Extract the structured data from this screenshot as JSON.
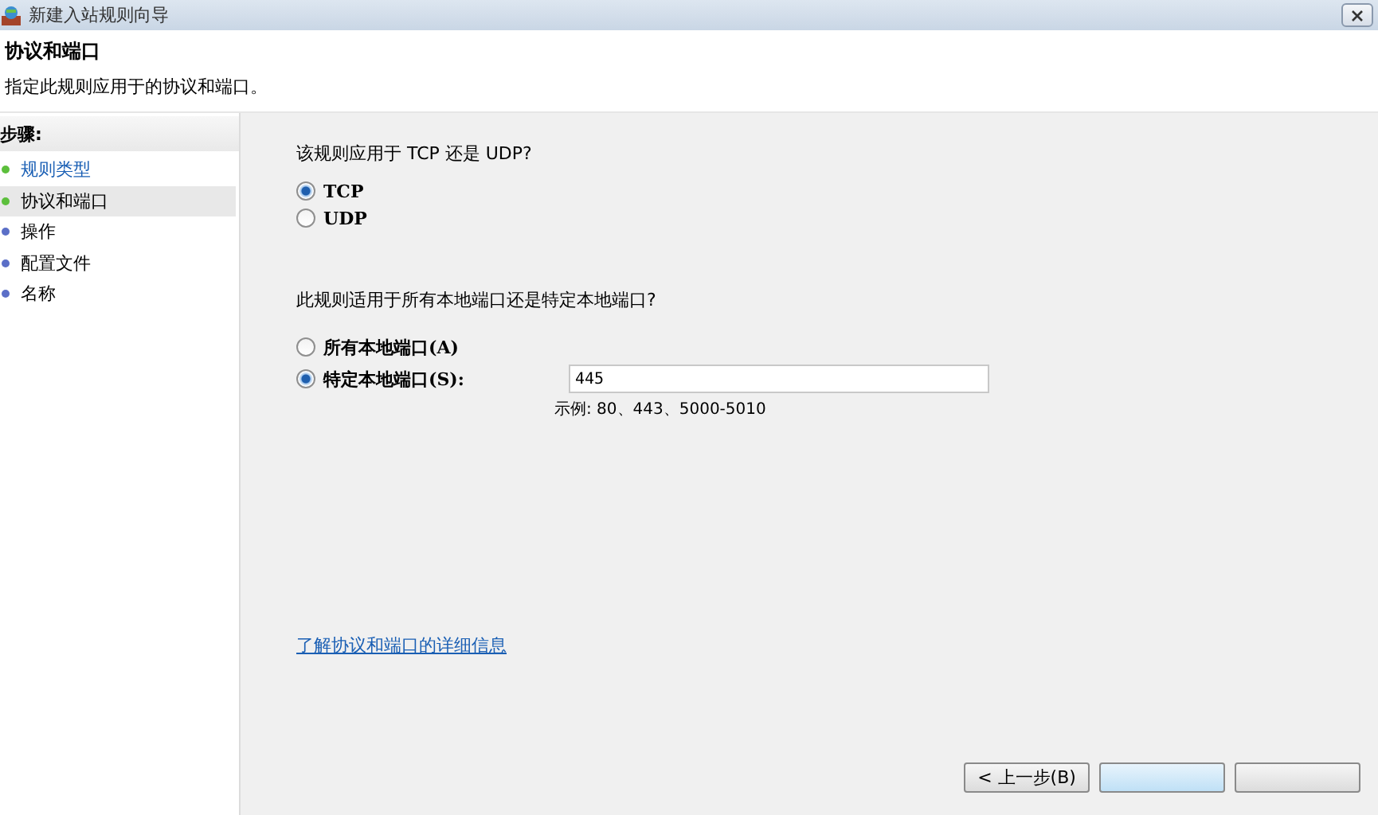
{
  "window": {
    "title": "新建入站规则向导"
  },
  "header": {
    "title": "协议和端口",
    "subtitle": "指定此规则应用于的协议和端口。"
  },
  "steps": {
    "heading": "步骤:",
    "items": [
      {
        "label": "规则类型",
        "done": true,
        "selected": false
      },
      {
        "label": "协议和端口",
        "done": true,
        "selected": true
      },
      {
        "label": "操作",
        "done": false,
        "selected": false
      },
      {
        "label": "配置文件",
        "done": false,
        "selected": false
      },
      {
        "label": "名称",
        "done": false,
        "selected": false
      }
    ]
  },
  "protocol": {
    "question": "该规则应用于 TCP 还是 UDP?",
    "options": [
      {
        "label": "TCP",
        "selected": true
      },
      {
        "label": "UDP",
        "selected": false
      }
    ]
  },
  "ports": {
    "question": "此规则适用于所有本地端口还是特定本地端口?",
    "options": [
      {
        "label": "所有本地端口(A)",
        "selected": false
      },
      {
        "label": "特定本地端口(S):",
        "selected": true
      }
    ],
    "value": "445",
    "example": "示例: 80、443、5000-5010"
  },
  "link": "了解协议和端口的详细信息",
  "buttons": {
    "back": "< 上一步(B)"
  }
}
